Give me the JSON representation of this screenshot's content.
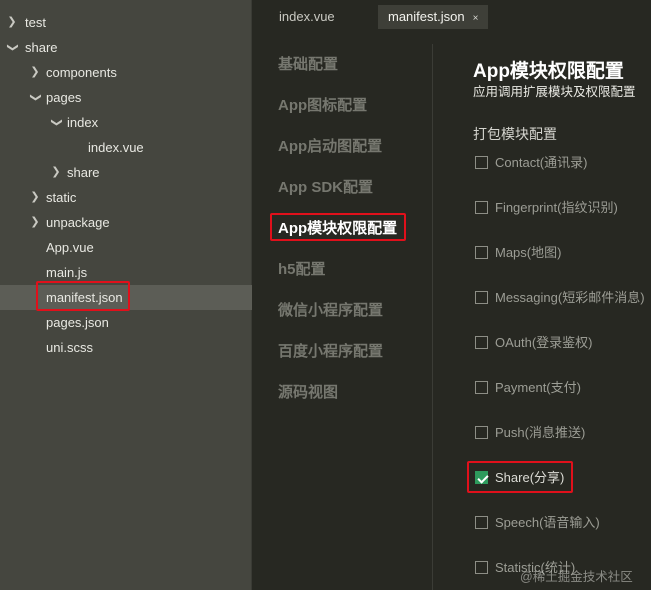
{
  "file_tree": [
    {
      "label": "test",
      "chevron": "right"
    },
    {
      "label": "share",
      "chevron": "down"
    },
    {
      "label": "components",
      "chevron": "right"
    },
    {
      "label": "pages",
      "chevron": "down"
    },
    {
      "label": "index",
      "chevron": "down"
    },
    {
      "label": "index.vue",
      "chevron": ""
    },
    {
      "label": "share",
      "chevron": "right"
    },
    {
      "label": "static",
      "chevron": "right"
    },
    {
      "label": "unpackage",
      "chevron": "right"
    },
    {
      "label": "App.vue",
      "chevron": ""
    },
    {
      "label": "main.js",
      "chevron": ""
    },
    {
      "label": "manifest.json",
      "chevron": "",
      "selected": true
    },
    {
      "label": "pages.json",
      "chevron": ""
    },
    {
      "label": "uni.scss",
      "chevron": ""
    }
  ],
  "tabs": [
    {
      "label": "index.vue",
      "active": false
    },
    {
      "label": "manifest.json",
      "active": true,
      "close": "×"
    }
  ],
  "settings_nav": [
    {
      "label": "基础配置"
    },
    {
      "label": "App图标配置"
    },
    {
      "label": "App启动图配置"
    },
    {
      "label": "App SDK配置"
    },
    {
      "label": "App模块权限配置",
      "active": true
    },
    {
      "label": "h5配置"
    },
    {
      "label": "微信小程序配置"
    },
    {
      "label": "百度小程序配置"
    },
    {
      "label": "源码视图"
    }
  ],
  "panel": {
    "title": "App模块权限配置",
    "subtitle": "应用调用扩展模块及权限配置",
    "section_title": "打包模块配置",
    "permissions": [
      {
        "label": "Contact(通讯录)",
        "checked": false
      },
      {
        "label": "Fingerprint(指纹识别)",
        "checked": false
      },
      {
        "label": "Maps(地图)",
        "checked": false
      },
      {
        "label": "Messaging(短彩邮件消息)",
        "checked": false
      },
      {
        "label": "OAuth(登录鉴权)",
        "checked": false
      },
      {
        "label": "Payment(支付)",
        "checked": false
      },
      {
        "label": "Push(消息推送)",
        "checked": false
      },
      {
        "label": "Share(分享)",
        "checked": true
      },
      {
        "label": "Speech(语音输入)",
        "checked": false
      },
      {
        "label": "Statistic(统计)",
        "checked": false
      }
    ]
  },
  "watermark": "@稀土掘金技术社区",
  "colors": {
    "sidebar_bg": "#45463f",
    "editor_bg": "#272822",
    "highlight_red": "#e0101b",
    "check_green": "#2e9b5d"
  }
}
